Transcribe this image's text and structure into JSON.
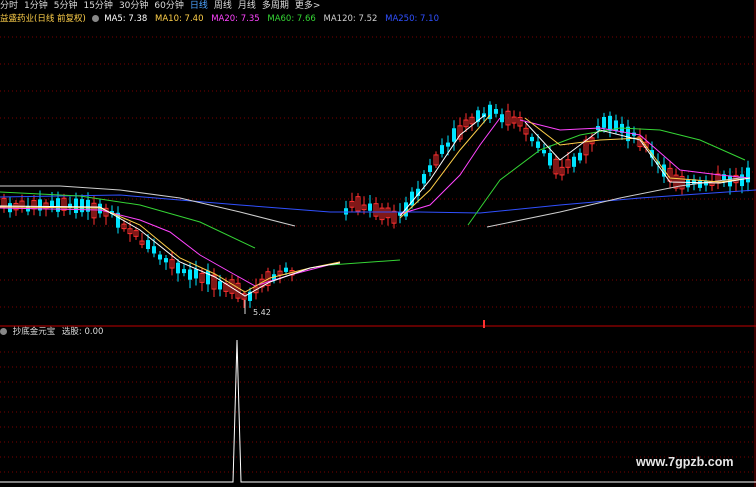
{
  "periods": [
    "分时",
    "1分钟",
    "5分钟",
    "15分钟",
    "30分钟",
    "60分钟",
    "日线",
    "周线",
    "月线",
    "多周期",
    "更多>"
  ],
  "active_period": "日线",
  "stock_title": "益盛药业(日线 前复权)",
  "ma": [
    {
      "label": "MA5: 7.38",
      "color": "#ffffff"
    },
    {
      "label": "MA10: 7.40",
      "color": "#ffd04a"
    },
    {
      "label": "MA20: 7.35",
      "color": "#ff44ff"
    },
    {
      "label": "MA60: 7.66",
      "color": "#35d435"
    },
    {
      "label": "MA120: 7.52",
      "color": "#cfcfcf"
    },
    {
      "label": "MA250: 7.10",
      "color": "#3050ff"
    }
  ],
  "low_label": "5.42",
  "indicator": {
    "name": "抄底金元宝",
    "value_label": "选股: 0.00"
  },
  "watermark": "www.7gpzb.com",
  "colors": {
    "up": "#ff3030",
    "down": "#00e5ff",
    "grid": "#7a0000"
  }
}
